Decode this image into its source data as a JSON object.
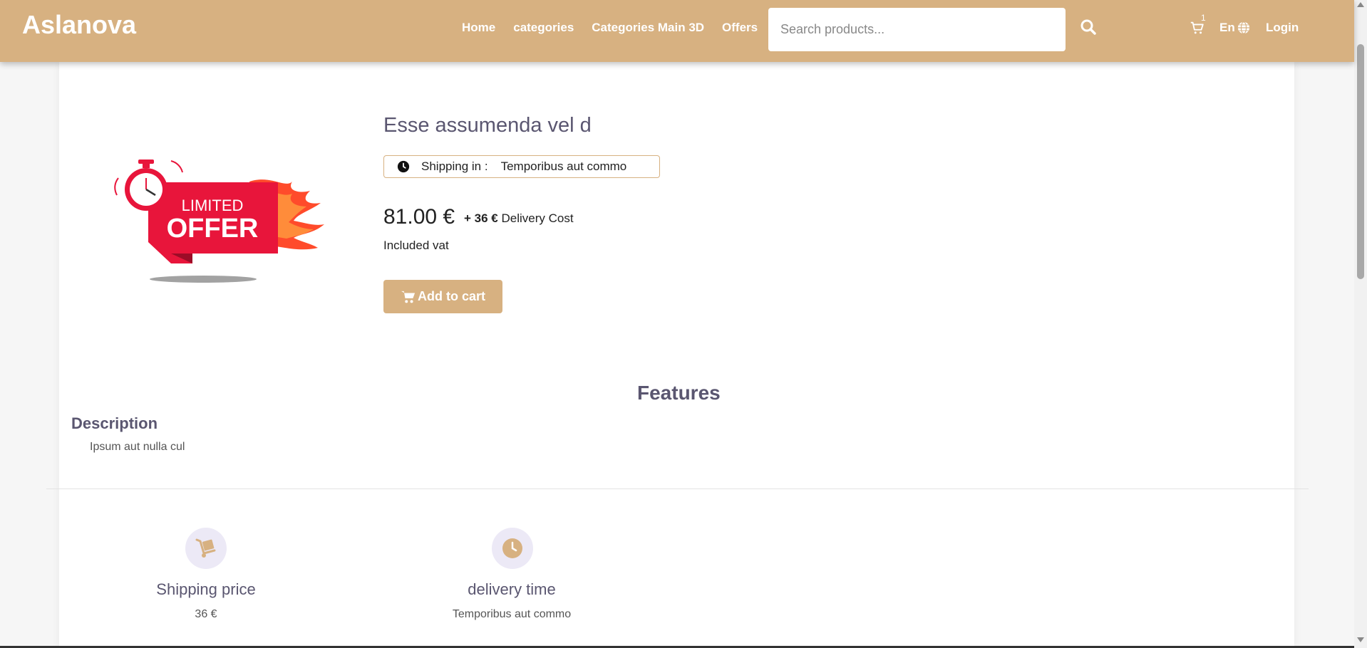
{
  "brand": "Aslanova",
  "colors": {
    "accent": "#d7b181",
    "title": "#5a5670",
    "icon_bg": "#ece9f6"
  },
  "nav": {
    "links": [
      "Home",
      "categories",
      "Categories Main 3D",
      "Offers"
    ],
    "search_placeholder": "Search products...",
    "cart_count": "1",
    "language": "En",
    "login": "Login"
  },
  "product": {
    "image_badge_top": "LIMITED",
    "image_badge_bottom": "OFFER",
    "title": "Esse assumenda vel d",
    "shipping_label": "Shipping in :",
    "shipping_value": "Temporibus aut commo",
    "price": "81.00 €",
    "delivery_amount": "+ 36 €",
    "delivery_label": "Delivery Cost",
    "vat": "Included vat",
    "add_to_cart": "Add to cart"
  },
  "features": {
    "heading": "Features",
    "description_title": "Description",
    "description_text": "Ipsum aut nulla cul",
    "items": [
      {
        "icon": "hand-truck-icon",
        "title": "Shipping price",
        "value": "36 €"
      },
      {
        "icon": "clock-icon",
        "title": "delivery time",
        "value": "Temporibus aut commo"
      }
    ]
  }
}
